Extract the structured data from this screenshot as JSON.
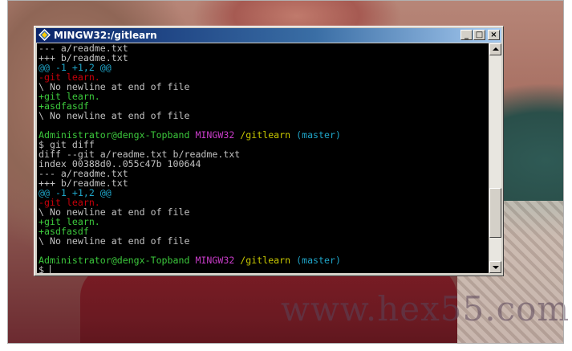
{
  "window": {
    "title": "MINGW32:/gitlearn",
    "buttons": {
      "minimize": "_",
      "maximize": "□",
      "close": "×"
    }
  },
  "watermark": "www.hex55.com",
  "scrollbar": {
    "position_fraction": 0.85
  },
  "colors": {
    "terminal_bg": "#000000",
    "default_text": "#c0c0c0",
    "red": "#c8000a",
    "green": "#3cc83c",
    "cyan": "#1fa5c8",
    "magenta": "#c83cc8",
    "yellow": "#c8c800",
    "titlebar": "#0a246a"
  },
  "terminal": {
    "lines": [
      [
        {
          "t": "--- a/readme.txt",
          "c": "white"
        }
      ],
      [
        {
          "t": "+++ b/readme.txt",
          "c": "white"
        }
      ],
      [
        {
          "t": "@@ -1 +1,2 @@",
          "c": "cyan"
        }
      ],
      [
        {
          "t": "-git learn.",
          "c": "red"
        }
      ],
      [
        {
          "t": "\\ No newline at end of file",
          "c": "white"
        }
      ],
      [
        {
          "t": "+git learn.",
          "c": "green"
        }
      ],
      [
        {
          "t": "+asdfasdf",
          "c": "green"
        }
      ],
      [
        {
          "t": "\\ No newline at end of file",
          "c": "white"
        }
      ],
      [],
      [
        {
          "t": "Administrator@dengx-Topband ",
          "c": "green"
        },
        {
          "t": "MINGW32 ",
          "c": "magenta"
        },
        {
          "t": "/gitlearn ",
          "c": "yellow"
        },
        {
          "t": "(master)",
          "c": "cyan"
        }
      ],
      [
        {
          "t": "$ git diff",
          "c": "white"
        }
      ],
      [
        {
          "t": "diff --git a/readme.txt b/readme.txt",
          "c": "white"
        }
      ],
      [
        {
          "t": "index 00388d0..055c47b 100644",
          "c": "white"
        }
      ],
      [
        {
          "t": "--- a/readme.txt",
          "c": "white"
        }
      ],
      [
        {
          "t": "+++ b/readme.txt",
          "c": "white"
        }
      ],
      [
        {
          "t": "@@ -1 +1,2 @@",
          "c": "cyan"
        }
      ],
      [
        {
          "t": "-git learn.",
          "c": "red"
        }
      ],
      [
        {
          "t": "\\ No newline at end of file",
          "c": "white"
        }
      ],
      [
        {
          "t": "+git learn.",
          "c": "green"
        }
      ],
      [
        {
          "t": "+asdfasdf",
          "c": "green"
        }
      ],
      [
        {
          "t": "\\ No newline at end of file",
          "c": "white"
        }
      ],
      [],
      [
        {
          "t": "Administrator@dengx-Topband ",
          "c": "green"
        },
        {
          "t": "MINGW32 ",
          "c": "magenta"
        },
        {
          "t": "/gitlearn ",
          "c": "yellow"
        },
        {
          "t": "(master)",
          "c": "cyan"
        }
      ],
      [
        {
          "t": "$ ",
          "c": "white"
        },
        {
          "cursor": true
        }
      ]
    ]
  }
}
